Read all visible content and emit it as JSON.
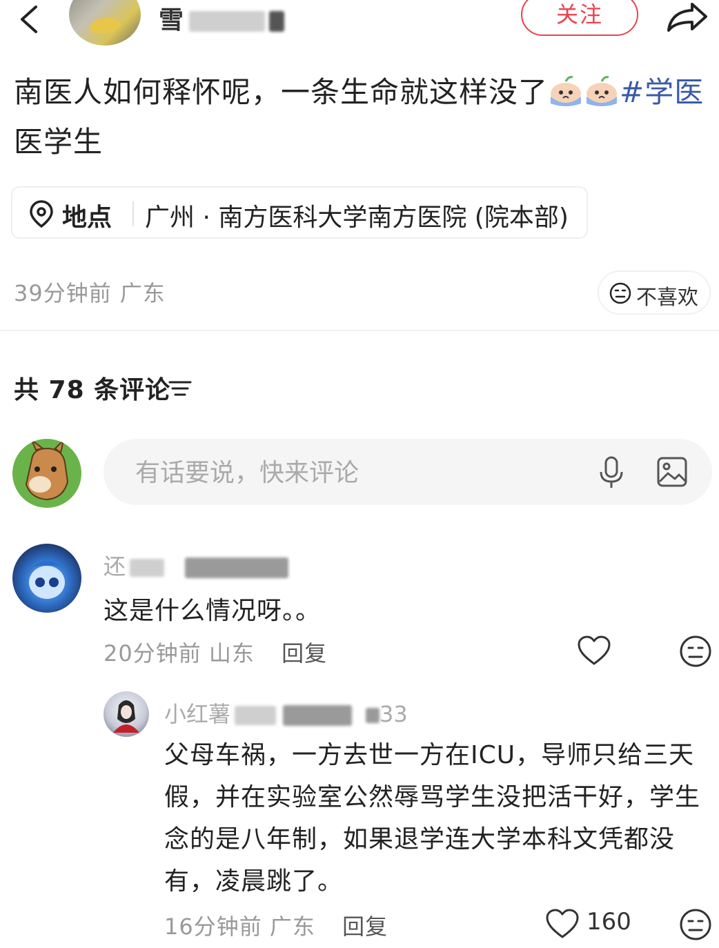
{
  "header": {
    "author_name_visible": "雪",
    "follow_label": "关注"
  },
  "post": {
    "text": "南医人如何释怀呢，一条生命就这样没了",
    "hashtag_1": "#学医",
    "hashtag_2": "医学生",
    "location_label": "地点",
    "location_text": "广州 · 南方医科大学南方医院 (院本部)",
    "time": "39分钟前",
    "region": "广东",
    "dislike_label": "不喜欢"
  },
  "comments_section": {
    "count_label": "共 78 条评论",
    "input_placeholder": "有话要说，快来评论"
  },
  "comments": [
    {
      "username_visible": "还",
      "text": "这是什么情况呀。。",
      "time": "20分钟前",
      "region": "山东",
      "reply_label": "回复"
    },
    {
      "username_visible": "小红薯",
      "username_suffix": "33",
      "text": "父母车祸，一方去世一方在ICU，导师只给三天假，并在实验室公然辱骂学生没把活干好，学生念的是八年制，如果退学连大学本科文凭都没有，凌晨跳了。",
      "time": "16分钟前",
      "region": "广东",
      "reply_label": "回复",
      "like_count": "160"
    }
  ],
  "colors": {
    "accent_red": "#e8434e",
    "hashtag_blue": "#3a5aa8",
    "meta_gray": "#999999"
  },
  "icons": [
    "back-arrow-icon",
    "share-icon",
    "location-pin-icon",
    "neutral-face-icon",
    "sort-icon",
    "microphone-icon",
    "image-icon",
    "heart-icon"
  ]
}
